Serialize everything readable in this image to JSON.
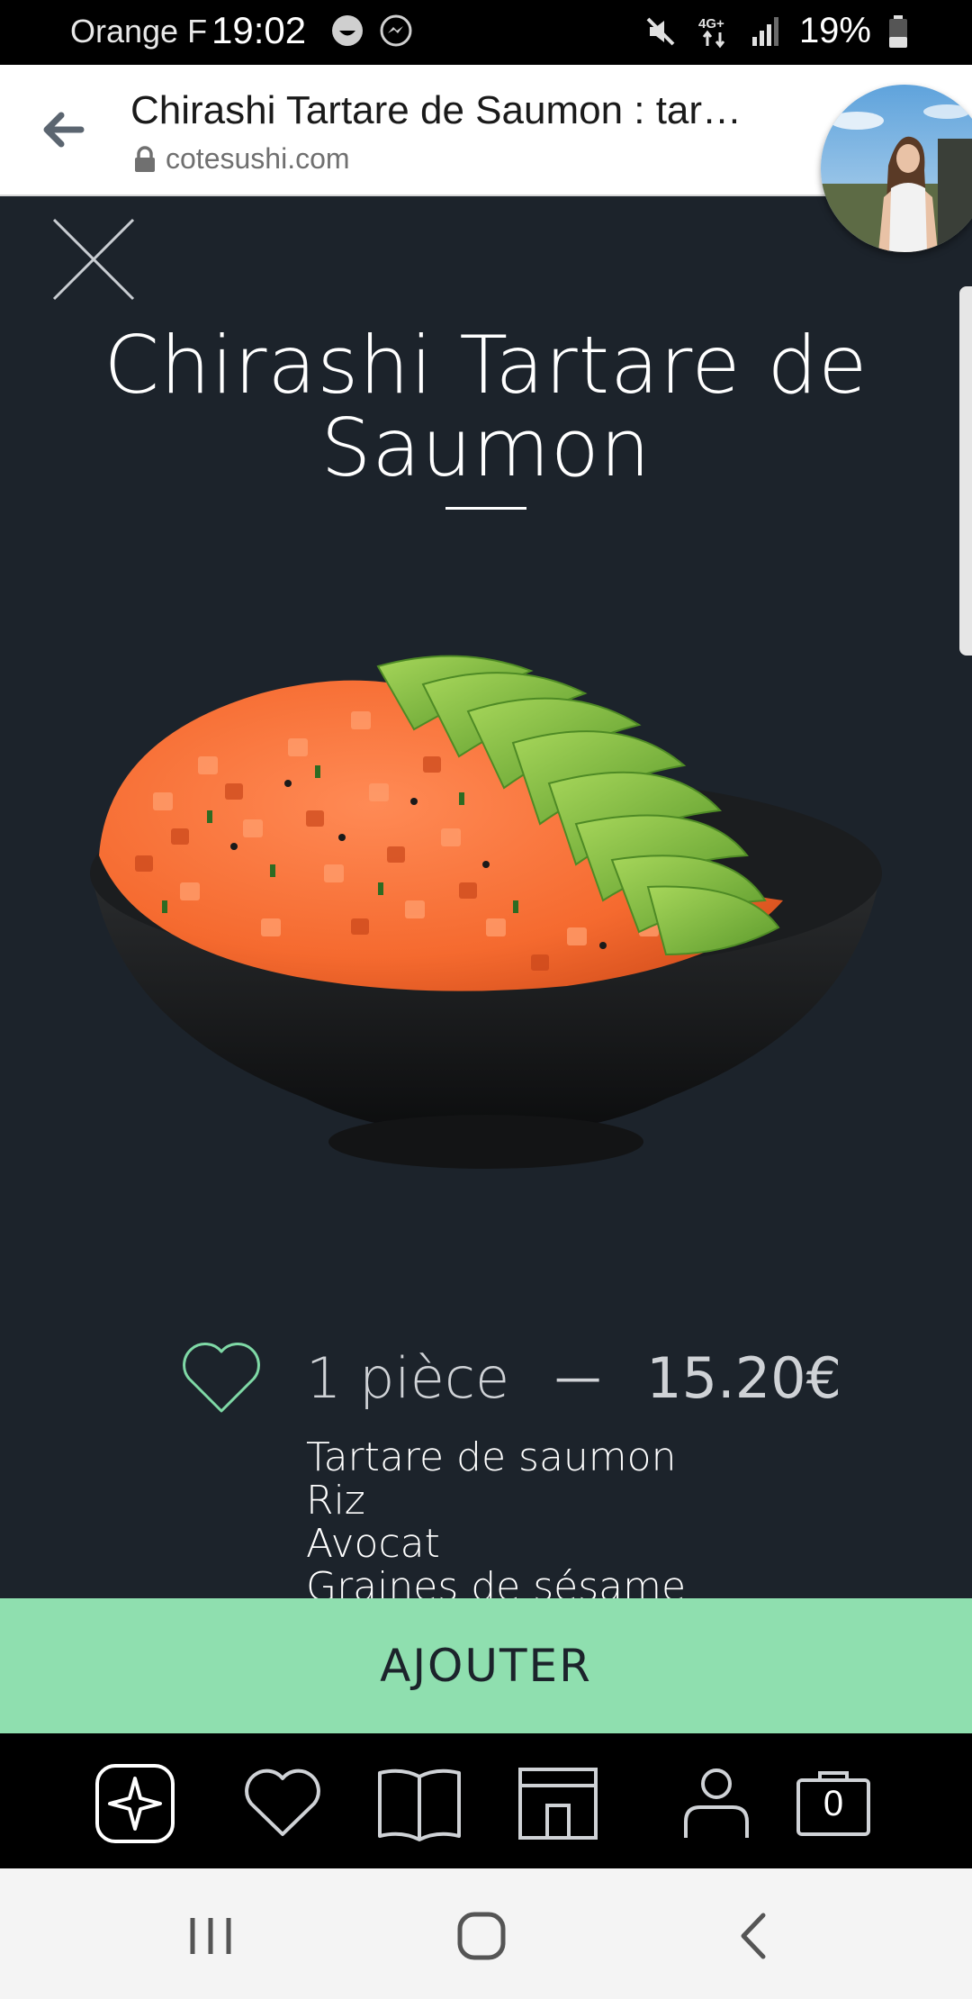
{
  "status_bar": {
    "carrier": "Orange F",
    "time": "19:02",
    "network": "4G+",
    "battery": "19%"
  },
  "browser": {
    "title": "Chirashi Tartare de Saumon : tar…",
    "url": "cotesushi.com"
  },
  "product": {
    "title": "Chirashi Tartare de Saumon",
    "quantity": "1 pièce",
    "separator": "—",
    "price": "15.20€",
    "ingredients": [
      "Tartare de saumon",
      "Riz",
      "Avocat",
      "Graines de sésame"
    ]
  },
  "actions": {
    "add_label": "AJOUTER"
  },
  "bottom_nav": {
    "items": [
      "home-logo-icon",
      "favorites-heart-icon",
      "menu-book-icon",
      "store-icon",
      "account-icon",
      "cart-icon"
    ],
    "cart_count": "0"
  },
  "colors": {
    "background": "#1c232b",
    "accent_green": "#8fdfaf",
    "heart_outline": "#7fd9a6"
  }
}
